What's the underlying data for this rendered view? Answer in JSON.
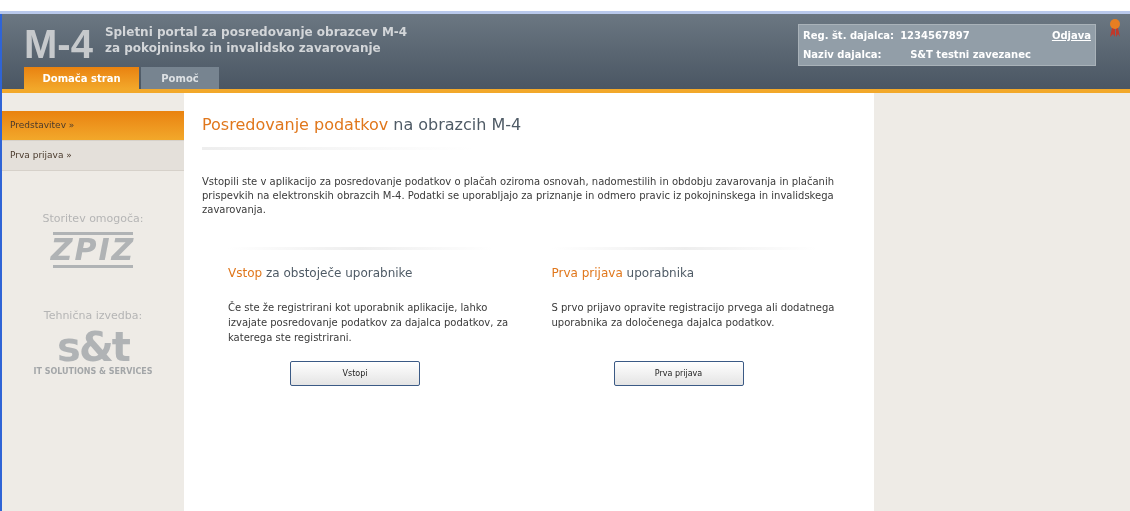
{
  "header": {
    "logo": "M-4",
    "title_lines": [
      "Spletni portal za posredovanje obrazcev M-4",
      "za pokojninsko in invalidsko zavarovanje"
    ],
    "user_box": {
      "reg_label": "Reg. št. dajalca:",
      "reg_value": "1234567897",
      "name_label": "Naziv dajalca:",
      "name_value": "S&T testni zavezanec",
      "logout": "Odjava"
    }
  },
  "tabs": [
    {
      "label": "Domača stran",
      "selected": true
    },
    {
      "label": "Pomoč",
      "selected": false
    }
  ],
  "sidebar": {
    "items": [
      {
        "label": "Predstavitev »",
        "selected": true
      },
      {
        "label": "Prva prijava »",
        "selected": false
      }
    ],
    "sponsors": [
      {
        "caption": "Storitev omogoča:",
        "kind": "zpiz",
        "logo_text": "ZPIZ"
      },
      {
        "caption": "Tehnična izvedba:",
        "kind": "st",
        "logo_text": "s&t",
        "tagline": "IT SOLUTIONS & SERVICES"
      }
    ]
  },
  "main": {
    "heading_accent": "Posredovanje podatkov",
    "heading_rest": "na obrazcih M-4",
    "intro": "Vstopili ste v aplikacijo za posredovanje podatkov o plačah oziroma osnovah, nadomestilih in obdobju zavarovanja in plačanih prispevkih na elektronskih obrazcih M-4. Podatki se uporabljajo za priznanje in odmero pravic iz pokojninskega in invalidskega zavarovanja.",
    "panels": [
      {
        "heading_accent": "Vstop",
        "heading_rest": "za obstoječe uporabnike",
        "text": "Če ste že registrirani kot uporabnik aplikacije, lahko izvajate posredovanje podatkov za dajalca podatkov, za katerega ste registrirani.",
        "button": "Vstopi"
      },
      {
        "heading_accent": "Prva prijava",
        "heading_rest": "uporabnika",
        "text": "S prvo prijavo opravite registracijo prvega ali dodatnega uporabnika za določenega dajalca podatkov.",
        "button": "Prva prijava"
      }
    ]
  }
}
